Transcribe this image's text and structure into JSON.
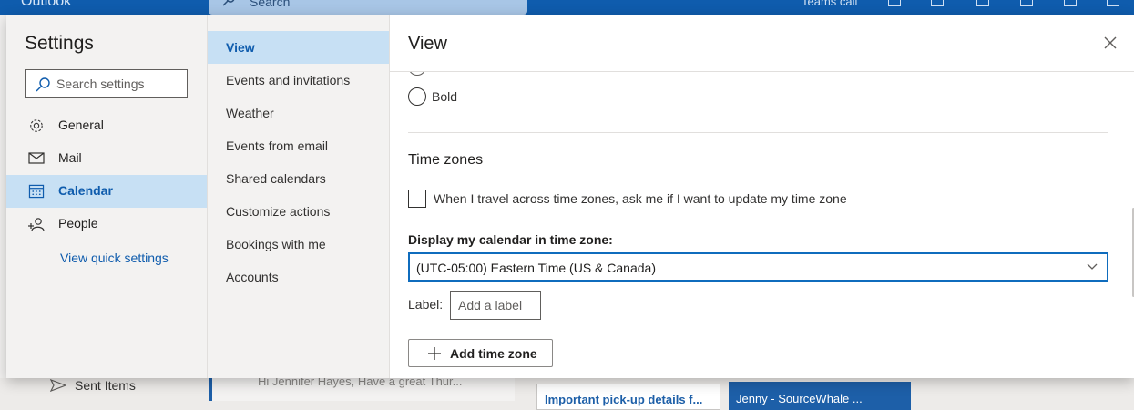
{
  "app": {
    "name": "Outlook",
    "search_placeholder": "Search",
    "teams_label": "Teams call"
  },
  "background": {
    "folder_sent": "Sent Items",
    "message_preview": "Hi Jennifer Hayes, Have a great Thur...",
    "card1_title": "Important pick-up details f...",
    "card2_title": "Jenny - SourceWhale ..."
  },
  "settings": {
    "title": "Settings",
    "search_placeholder": "Search settings",
    "categories": [
      {
        "label": "General",
        "icon": "gear-icon"
      },
      {
        "label": "Mail",
        "icon": "mail-icon"
      },
      {
        "label": "Calendar",
        "icon": "calendar-icon",
        "active": true
      },
      {
        "label": "People",
        "icon": "people-icon"
      }
    ],
    "view_quick_settings": "View quick settings",
    "subcategories": [
      {
        "label": "View",
        "active": true
      },
      {
        "label": "Events and invitations"
      },
      {
        "label": "Weather"
      },
      {
        "label": "Events from email"
      },
      {
        "label": "Shared calendars"
      },
      {
        "label": "Customize actions"
      },
      {
        "label": "Bookings with me"
      },
      {
        "label": "Accounts"
      }
    ]
  },
  "pane": {
    "title": "View",
    "radio_bold_label": "Bold",
    "time_zones": {
      "title": "Time zones",
      "checkbox_label": "When I travel across time zones, ask me if I want to update my time zone",
      "checkbox_checked": false,
      "display_label": "Display my calendar in time zone:",
      "selected_zone": "(UTC-05:00) Eastern Time (US & Canada)",
      "label_text": "Label:",
      "label_placeholder": "Add a label",
      "add_button": "Add time zone"
    }
  },
  "colors": {
    "accent": "#0f5cad",
    "selected_bg": "#c7e0f4",
    "panel_bg": "#f3f2f1"
  }
}
